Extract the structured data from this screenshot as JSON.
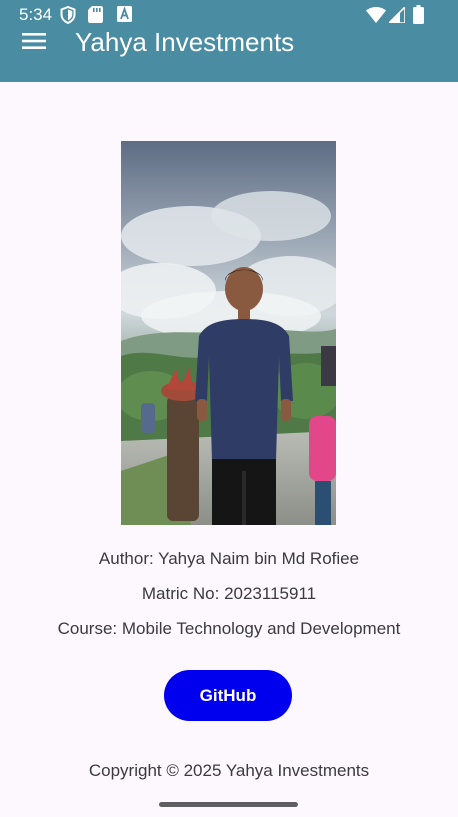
{
  "status_bar": {
    "time": "5:34",
    "icons": [
      "shield-icon",
      "sd-card-icon",
      "font-a-icon",
      "wifi-icon",
      "cell-signal-icon",
      "battery-icon"
    ]
  },
  "app_bar": {
    "menu_icon": "hamburger-menu-icon",
    "title": "Yahya Investments",
    "color": "#4A8CA2"
  },
  "profile": {
    "photo": "profile-photo",
    "author": "Author: Yahya Naim bin Md Rofiee",
    "matric": "Matric No: 2023115911",
    "course": "Course: Mobile Technology and Development"
  },
  "github_button": {
    "label": "GitHub",
    "color": "#0000EE"
  },
  "footer": {
    "copyright": "Copyright © 2025 Yahya Investments"
  },
  "colors": {
    "background": "#FDF7FE",
    "text": "#3b3b3f"
  }
}
